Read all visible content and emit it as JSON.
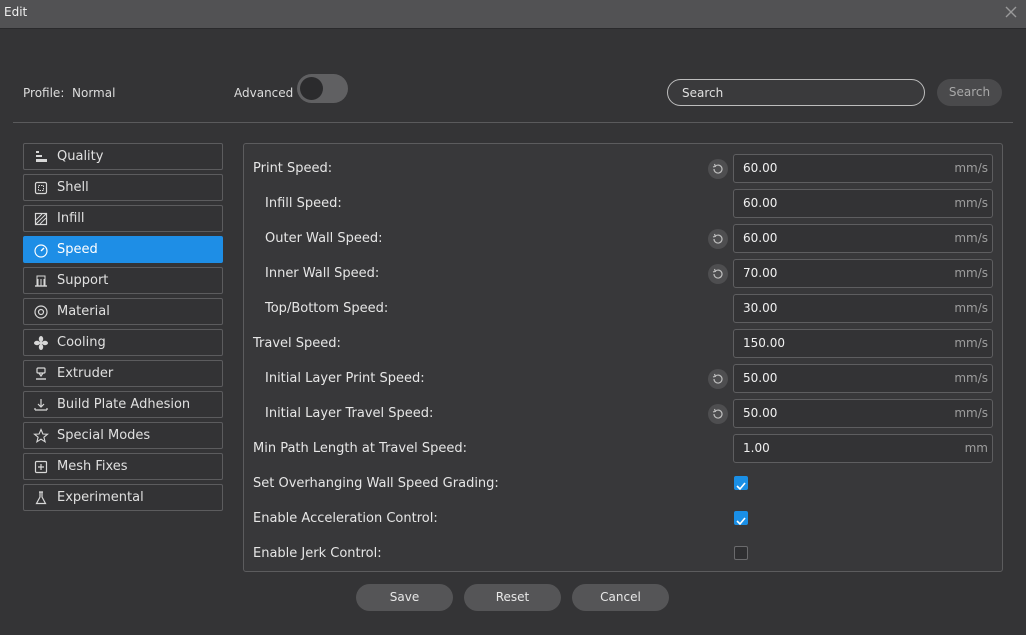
{
  "window": {
    "title": "Edit",
    "close_icon": "close-icon"
  },
  "profile": {
    "label": "Profile:",
    "value": "Normal"
  },
  "advanced": {
    "label": "Advanced",
    "enabled": false
  },
  "search": {
    "placeholder": "Search",
    "button_label": "Search"
  },
  "sidebar": {
    "items": [
      {
        "label": "Quality",
        "icon": "quality-icon",
        "active": false
      },
      {
        "label": "Shell",
        "icon": "shell-icon",
        "active": false
      },
      {
        "label": "Infill",
        "icon": "infill-icon",
        "active": false
      },
      {
        "label": "Speed",
        "icon": "speed-icon",
        "active": true
      },
      {
        "label": "Support",
        "icon": "support-icon",
        "active": false
      },
      {
        "label": "Material",
        "icon": "material-icon",
        "active": false
      },
      {
        "label": "Cooling",
        "icon": "cooling-fan-icon",
        "active": false
      },
      {
        "label": "Extruder",
        "icon": "extruder-icon",
        "active": false
      },
      {
        "label": "Build Plate Adhesion",
        "icon": "build-plate-icon",
        "active": false
      },
      {
        "label": "Special Modes",
        "icon": "star-icon",
        "active": false
      },
      {
        "label": "Mesh Fixes",
        "icon": "mesh-fix-icon",
        "active": false
      },
      {
        "label": "Experimental",
        "icon": "flask-icon",
        "active": false
      }
    ]
  },
  "settings": [
    {
      "label": "Print Speed:",
      "value": "60.00",
      "unit": "mm/s",
      "reset": true
    },
    {
      "label": "Infill Speed:",
      "value": "60.00",
      "unit": "mm/s",
      "reset": false
    },
    {
      "label": "Outer Wall Speed:",
      "value": "60.00",
      "unit": "mm/s",
      "reset": true
    },
    {
      "label": "Inner Wall Speed:",
      "value": "70.00",
      "unit": "mm/s",
      "reset": true
    },
    {
      "label": "Top/Bottom Speed:",
      "value": "30.00",
      "unit": "mm/s",
      "reset": false
    },
    {
      "label": "Travel Speed:",
      "value": "150.00",
      "unit": "mm/s",
      "reset": false
    },
    {
      "label": "Initial Layer Print Speed:",
      "value": "50.00",
      "unit": "mm/s",
      "reset": true
    },
    {
      "label": "Initial Layer Travel Speed:",
      "value": "50.00",
      "unit": "mm/s",
      "reset": true
    },
    {
      "label": "Min Path Length at Travel Speed:",
      "value": "1.00",
      "unit": "mm",
      "reset": false
    },
    {
      "label": "Set Overhanging Wall Speed Grading:",
      "checked": true
    },
    {
      "label": "Enable Acceleration Control:",
      "checked": true
    },
    {
      "label": "Enable Jerk Control:",
      "checked": false
    }
  ],
  "footer": {
    "save_label": "Save",
    "reset_label": "Reset",
    "cancel_label": "Cancel"
  },
  "colors": {
    "accent": "#1e8ee6",
    "background": "#343436"
  }
}
